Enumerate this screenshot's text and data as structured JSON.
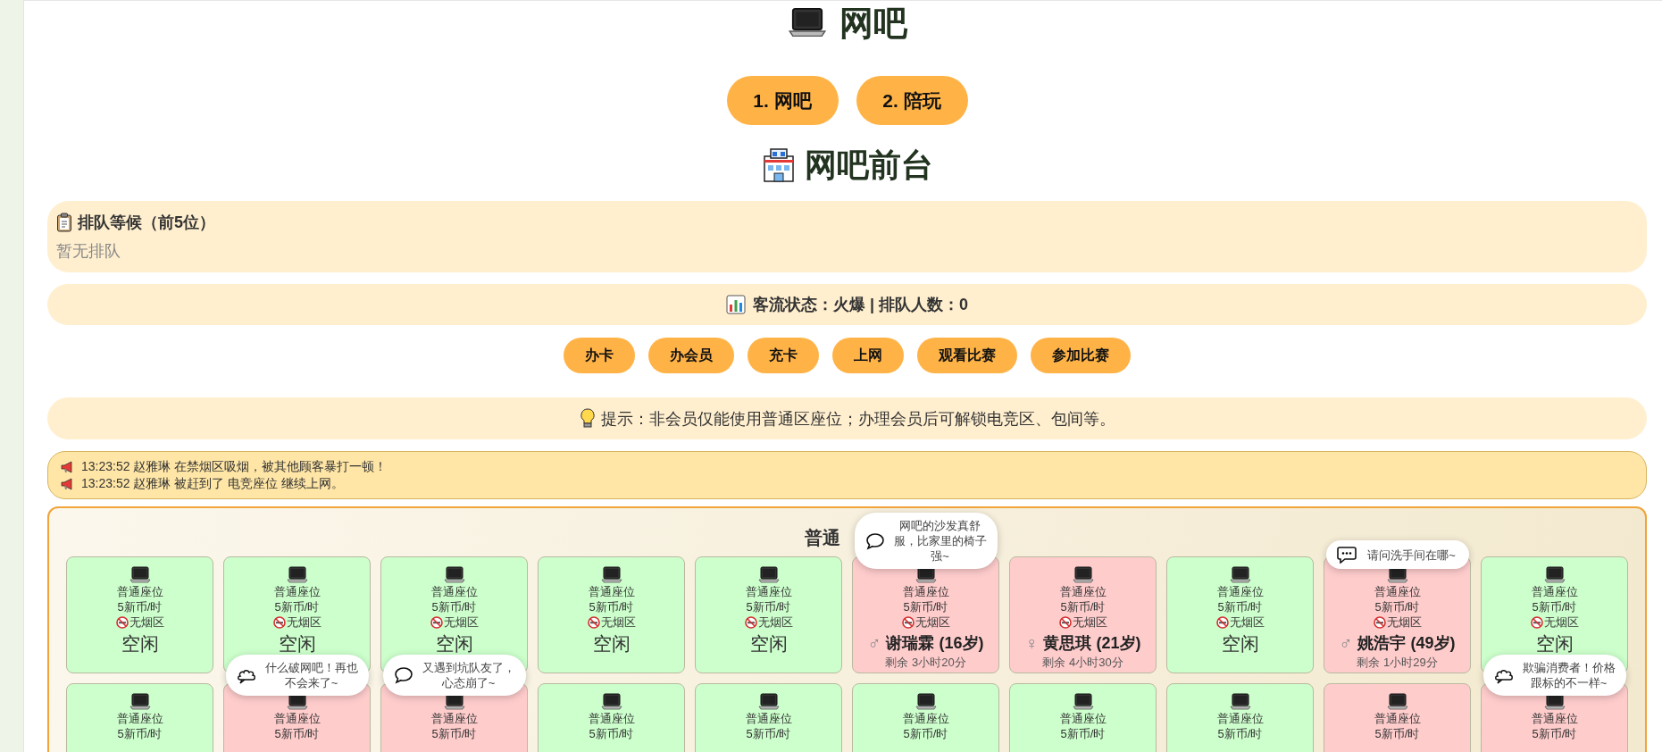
{
  "title": "网吧",
  "nav": [
    {
      "label": "1. 网吧"
    },
    {
      "label": "2. 陪玩"
    }
  ],
  "heading": "网吧前台",
  "queue": {
    "title": "排队等候（前5位）",
    "empty_text": "暂无排队"
  },
  "traffic": "客流状态：火爆 | 排队人数：0",
  "actions": [
    "办卡",
    "办会员",
    "充卡",
    "上网",
    "观看比赛",
    "参加比赛"
  ],
  "tip": "提示：非会员仅能使用普通区座位；办理会员后可解锁电竞区、包间等。",
  "log": [
    {
      "text": "13:23:52 赵雅琳 在禁烟区吸烟，被其他顾客暴打一顿！"
    },
    {
      "text": "13:23:52 赵雅琳 被赶到了 电竞座位 继续上网。"
    }
  ],
  "zone_area": {
    "title": "普通",
    "seats": [
      {
        "occupied": false,
        "type": "普通座位",
        "price": "5新币/时",
        "zone": "无烟区",
        "status": "空闲"
      },
      {
        "occupied": false,
        "type": "普通座位",
        "price": "5新币/时",
        "zone": "无烟区",
        "status": "空闲"
      },
      {
        "occupied": false,
        "type": "普通座位",
        "price": "5新币/时",
        "zone": "无烟区",
        "status": "空闲"
      },
      {
        "occupied": false,
        "type": "普通座位",
        "price": "5新币/时",
        "zone": "无烟区",
        "status": "空闲"
      },
      {
        "occupied": false,
        "type": "普通座位",
        "price": "5新币/时",
        "zone": "无烟区",
        "status": "空闲"
      },
      {
        "occupied": true,
        "type": "普通座位",
        "price": "5新币/时",
        "zone": "无烟区",
        "gender": "♂",
        "occupant": "谢瑞霖 (16岁)",
        "remaining": "剩余 3小时20分",
        "bubble": {
          "kind": "remark",
          "text": "网吧的沙发真舒服，比家里的椅子强~"
        }
      },
      {
        "occupied": true,
        "type": "普通座位",
        "price": "5新币/时",
        "zone": "无烟区",
        "gender": "♀",
        "occupant": "黄思琪 (21岁)",
        "remaining": "剩余 4小时30分"
      },
      {
        "occupied": false,
        "type": "普通座位",
        "price": "5新币/时",
        "zone": "无烟区",
        "status": "空闲"
      },
      {
        "occupied": true,
        "type": "普通座位",
        "price": "5新币/时",
        "zone": "无烟区",
        "gender": "♂",
        "occupant": "姚浩宇 (49岁)",
        "remaining": "剩余 1小时29分",
        "bubble": {
          "kind": "question",
          "text": "请问洗手间在哪~"
        }
      },
      {
        "occupied": false,
        "type": "普通座位",
        "price": "5新币/时",
        "zone": "无烟区",
        "status": "空闲"
      },
      {
        "occupied": false,
        "type": "普通座位",
        "price": "5新币/时"
      },
      {
        "occupied": true,
        "type": "普通座位",
        "price": "5新币/时",
        "bubble": {
          "kind": "complaint",
          "text": "什么破网吧！再也不会来了~"
        }
      },
      {
        "occupied": true,
        "type": "普通座位",
        "price": "5新币/时",
        "bubble": {
          "kind": "remark",
          "text": "又遇到坑队友了，心态崩了~"
        }
      },
      {
        "occupied": false,
        "type": "普通座位",
        "price": "5新币/时"
      },
      {
        "occupied": false,
        "type": "普通座位",
        "price": "5新币/时"
      },
      {
        "occupied": false,
        "type": "普通座位",
        "price": "5新币/时"
      },
      {
        "occupied": false,
        "type": "普通座位",
        "price": "5新币/时"
      },
      {
        "occupied": false,
        "type": "普通座位",
        "price": "5新币/时"
      },
      {
        "occupied": true,
        "type": "普通座位",
        "price": "5新币/时"
      },
      {
        "occupied": true,
        "type": "普通座位",
        "price": "5新币/时",
        "bubble": {
          "kind": "complaint",
          "text": "欺骗消费者！价格跟标的不一样~"
        }
      }
    ]
  }
}
